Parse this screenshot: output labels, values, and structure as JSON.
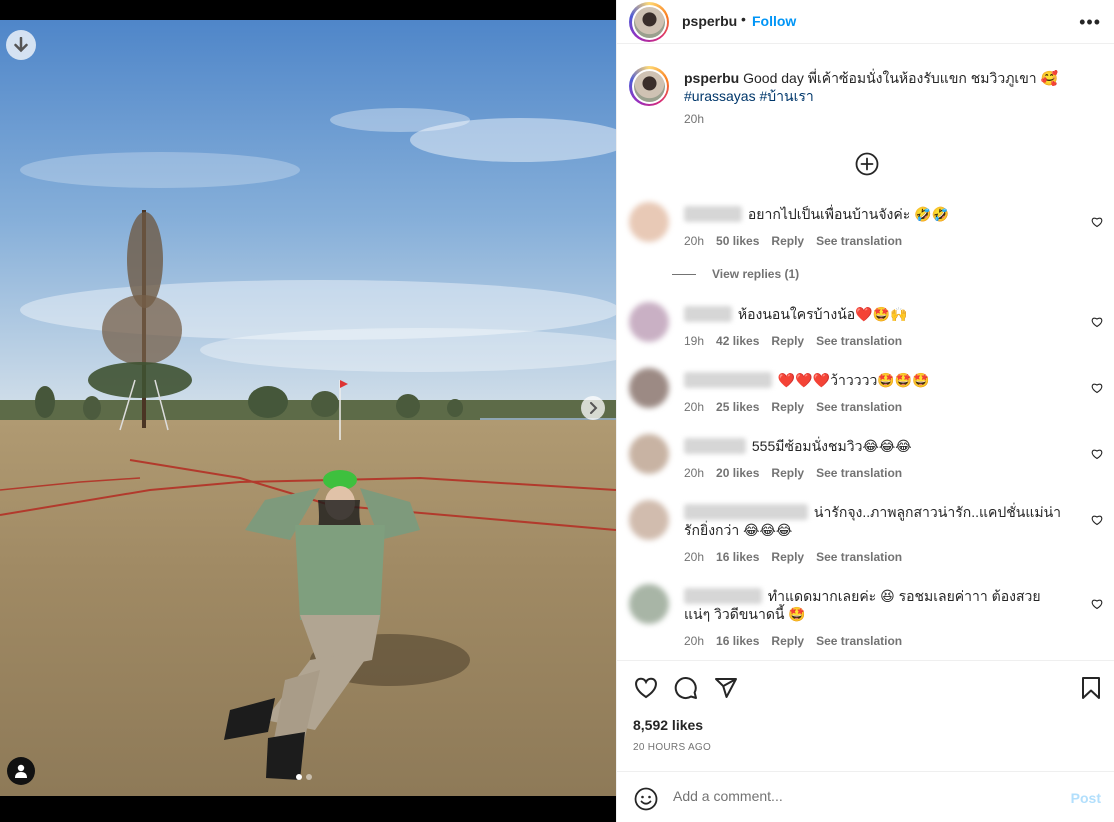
{
  "post": {
    "username": "psperbu",
    "separator": "•",
    "follow_label": "Follow",
    "more_label": "•••"
  },
  "caption": {
    "username": "psperbu",
    "text": "Good day พี่เค้าซ้อมนั่งในห้องรับแขก ชมวิวภูเขา 🥰",
    "hashtags": "#urassayas #บ้านเรา",
    "time": "20h"
  },
  "comments": [
    {
      "text": "อยากไปเป็นเพื่อนบ้านจังค่ะ 🤣🤣",
      "time": "20h",
      "likes": "50 likes",
      "reply": "Reply",
      "translate": "See translation",
      "avatar_color": "#e8c9b6"
    },
    {
      "text": "ห้องนอนใครบ้างน้อ❤️🤩🙌",
      "time": "19h",
      "likes": "42 likes",
      "reply": "Reply",
      "translate": "See translation",
      "avatar_color": "#c9b0c4"
    },
    {
      "text": "❤️❤️❤️ว้าวววว🤩🤩🤩",
      "time": "20h",
      "likes": "25 likes",
      "reply": "Reply",
      "translate": "See translation",
      "avatar_color": "#9c8a84"
    },
    {
      "text": "555มีซ้อมนั่งชมวิว😂😂😂",
      "time": "20h",
      "likes": "20 likes",
      "reply": "Reply",
      "translate": "See translation",
      "avatar_color": "#c8b3a3"
    },
    {
      "text": "น่ารักจุง..ภาพลูกสาวน่ารัก..แคปชั่นแม่น่ารักยิ่งกว่า 😂😂😂",
      "time": "20h",
      "likes": "16 likes",
      "reply": "Reply",
      "translate": "See translation",
      "avatar_color": "#d1bcae"
    },
    {
      "text": "ทำแดดมากเลยค่ะ 😆 รอชมเลยค่าาา ต้องสวยแน่ๆ วิวดีขนาดนี้ 🤩",
      "time": "20h",
      "likes": "16 likes",
      "reply": "Reply",
      "translate": "See translation",
      "avatar_color": "#a8b5a6"
    }
  ],
  "view_replies": "View replies (1)",
  "likes_count": "8,592 likes",
  "posted_ago": "20 HOURS AGO",
  "add_comment": {
    "placeholder": "Add a comment...",
    "post_label": "Post"
  },
  "colors": {
    "link_blue": "#0095f6",
    "hashtag_blue": "#00376b",
    "secondary_text": "#737373",
    "post_disabled": "#b2dffc"
  }
}
